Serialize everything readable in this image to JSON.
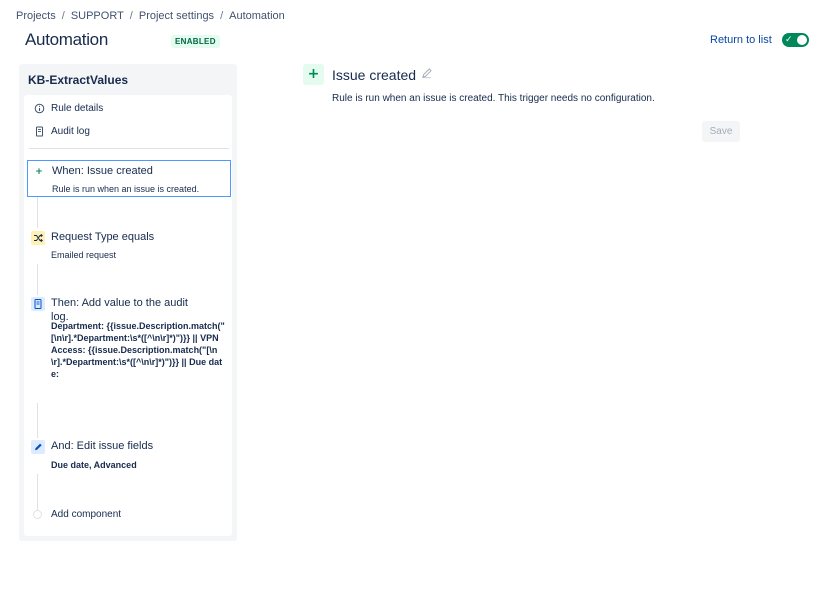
{
  "breadcrumb": [
    "Projects",
    "SUPPORT",
    "Project settings",
    "Automation"
  ],
  "breadcrumb_separator": "/",
  "page_title": "Automation",
  "status_lozenge": "ENABLED",
  "return_link": "Return to list",
  "toggle": {
    "enabled": true,
    "icon": "check-icon"
  },
  "rule": {
    "name": "KB-ExtractValues",
    "nav": [
      {
        "label": "Rule details",
        "icon": "info-icon"
      },
      {
        "label": "Audit log",
        "icon": "document-icon"
      }
    ],
    "components": {
      "trigger": {
        "title": "When: Issue created",
        "subtitle": "Rule is run when an issue is created.",
        "icon": "plus-icon"
      },
      "condition": {
        "title": "Request Type equals",
        "subtitle": "Emailed request",
        "icon": "shuffle-icon"
      },
      "audit_action": {
        "title": "Then: Add value to the audit log.",
        "body": "Department: {{issue.Description.match(\"[\\n\\r].*Department:\\s*([^\\n\\r]*)\")}} || VPN Access: {{issue.Description.match(\"[\\n\\r].*Department:\\s*([^\\n\\r]*)\")}} || Due date:",
        "icon": "document-icon"
      },
      "edit_action": {
        "title": "And: Edit issue fields",
        "subtitle": "Due date, Advanced",
        "icon": "pencil-icon"
      }
    },
    "add_component": "Add component"
  },
  "detail": {
    "title": "Issue created",
    "description": "Rule is run when an issue is created. This trigger needs no configuration.",
    "save_label": "Save"
  },
  "colors": {
    "accent": "#0052cc",
    "link": "#0747a6",
    "success": "#00875a",
    "selected_border": "#4c9aff",
    "condition_bg": "#fff0b3",
    "action_bg": "#deebff"
  }
}
